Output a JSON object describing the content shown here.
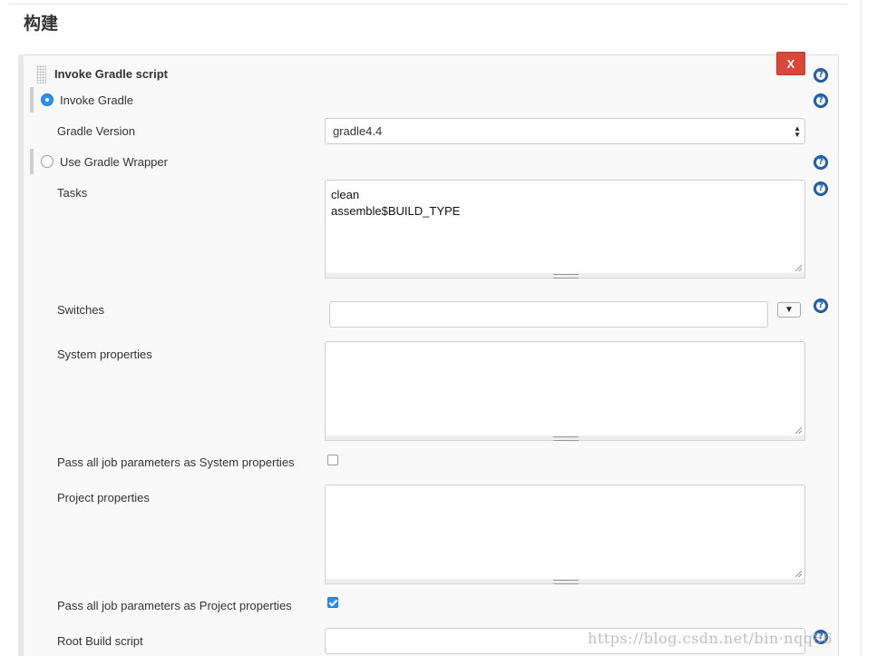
{
  "section": {
    "title": "构建"
  },
  "step": {
    "title": "Invoke Gradle script",
    "delete_label": "X",
    "help_glyph": "?"
  },
  "invoke_gradle": {
    "label": "Invoke Gradle",
    "selected": true,
    "gradle_version_label": "Gradle Version",
    "gradle_version_value": "gradle4.4"
  },
  "use_wrapper": {
    "label": "Use Gradle Wrapper",
    "selected": false
  },
  "fields": {
    "tasks_label": "Tasks",
    "tasks_value": "clean\nassemble$BUILD_TYPE",
    "switches_label": "Switches",
    "switches_value": "",
    "switches_dropdown_glyph": "▼",
    "system_properties_label": "System properties",
    "system_properties_value": "",
    "pass_system_label": "Pass all job parameters as System properties",
    "pass_system_checked": false,
    "project_properties_label": "Project properties",
    "project_properties_value": "",
    "pass_project_label": "Pass all job parameters as Project properties",
    "pass_project_checked": true,
    "root_build_script_label": "Root Build script",
    "root_build_script_value": ""
  },
  "watermark": {
    "text": "https://blog.csdn.net/bin·nqq86"
  },
  "colors": {
    "delete_button": "#d9473a",
    "help_icon": "#2b63a8",
    "radio_checked": "#2c8ff0",
    "panel_background": "#f9f9f9"
  },
  "icons": {
    "help": "question-circle-icon",
    "drag": "drag-handle-icon",
    "select_arrows": "up-down-arrows-icon",
    "resize": "resize-grip-icon"
  }
}
